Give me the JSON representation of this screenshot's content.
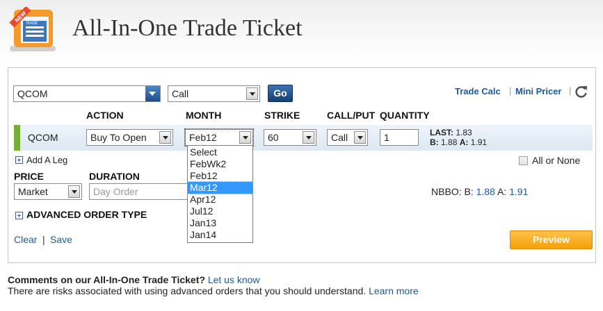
{
  "header": {
    "title": "All-In-One Trade Ticket",
    "logo_badge": "NEW",
    "logo_caption": "RADE"
  },
  "top_bar": {
    "symbol_value": "QCOM",
    "type_value": "Call",
    "go_label": "Go",
    "trade_calc_label": "Trade Calc",
    "separator": "|",
    "mini_pricer_label": "Mini Pricer",
    "refresh_icon": "refresh-icon"
  },
  "columns": {
    "action": "ACTION",
    "month": "MONTH",
    "strike": "STRIKE",
    "call_put": "CALL/PUT",
    "quantity": "QUANTITY"
  },
  "leg": {
    "symbol": "QCOM",
    "action_value": "Buy To Open",
    "month_value": "Feb12",
    "strike_value": "60",
    "call_put_value": "Call",
    "quantity_value": "1",
    "last_label": "LAST:",
    "last_value": "1.83",
    "bid_label": "B:",
    "bid_value": "1.88",
    "ask_label": "A:",
    "ask_value": "1.91"
  },
  "month_dropdown": {
    "options": [
      "Select",
      "FebWk2",
      "Feb12",
      "Mar12",
      "Apr12",
      "Jul12",
      "Jan13",
      "Jan14"
    ],
    "highlighted": "Mar12"
  },
  "add_leg_label": "Add A Leg",
  "all_or_none_label": "All or None",
  "price": {
    "label": "PRICE",
    "value": "Market"
  },
  "duration": {
    "label": "DURATION",
    "placeholder": "Day Order"
  },
  "nbbo": {
    "label": "NBBO:",
    "bid_label": "B:",
    "bid_value": "1.88",
    "ask_label": "A:",
    "ask_value": "1.91"
  },
  "advanced_order_label": "ADVANCED ORDER TYPE",
  "footer_links": {
    "clear": "Clear",
    "separator": "|",
    "save": "Save"
  },
  "preview_label": "Preview",
  "bottom": {
    "comments_text": "Comments on our All-In-One Trade Ticket?",
    "let_us_know": "Let us know",
    "risk_text": "There are risks associated with using advanced orders that you should understand.",
    "learn_more": "Learn more"
  },
  "colors": {
    "link": "#1a5aa6",
    "accent_green": "#78ad3a",
    "preview_orange": "#f5a006",
    "highlight": "#3399ff"
  }
}
